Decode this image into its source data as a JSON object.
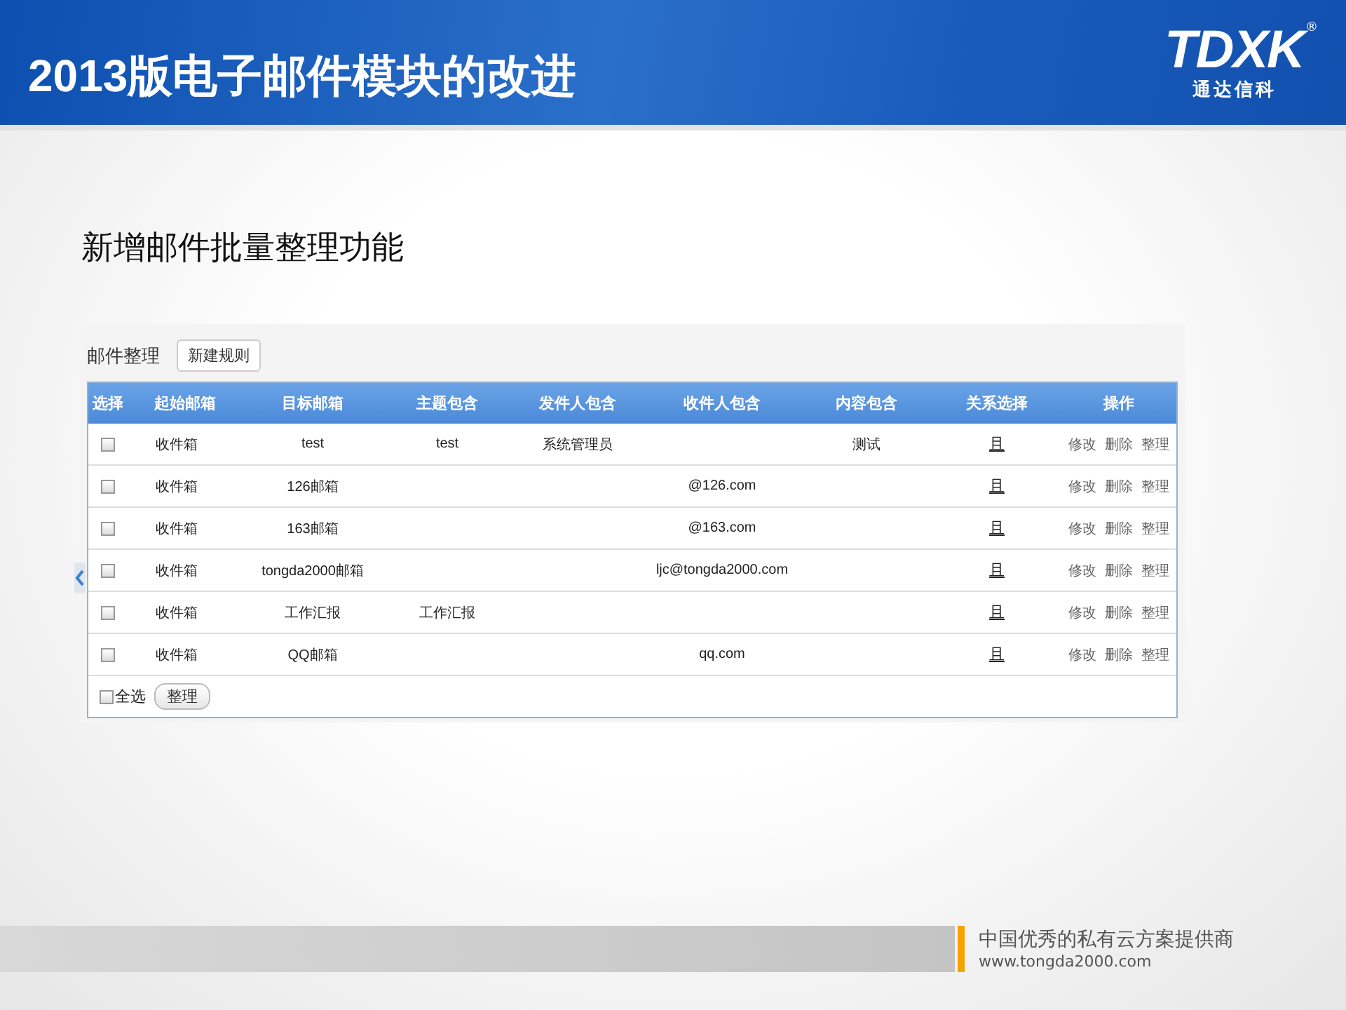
{
  "slide": {
    "title": "2013版电子邮件模块的改进",
    "logo": {
      "mark": "TDXK",
      "name": "通达信科",
      "registered": "®"
    },
    "subtitle": "新增邮件批量整理功能"
  },
  "panel": {
    "title": "邮件整理",
    "new_rule_button": "新建规则",
    "columns": [
      "选择",
      "起始邮箱",
      "目标邮箱",
      "主题包含",
      "发件人包含",
      "收件人包含",
      "内容包含",
      "关系选择",
      "操作"
    ],
    "rows": [
      {
        "checked": false,
        "source": "收件箱",
        "target": "test",
        "subject": "test",
        "sender": "系统管理员",
        "content": "测试",
        "relation": "且",
        "actions": [
          "修改",
          "删除",
          "整理"
        ]
      },
      {
        "checked": false,
        "source": "收件箱",
        "target": "126邮箱",
        "recipient": "@126.com",
        "relation": "且",
        "actions": [
          "修改",
          "删除",
          "整理"
        ]
      },
      {
        "checked": false,
        "source": "收件箱",
        "target": "163邮箱",
        "recipient": "@163.com",
        "relation": "且",
        "actions": [
          "修改",
          "删除",
          "整理"
        ]
      },
      {
        "checked": false,
        "source": "收件箱",
        "target": "tongda2000邮箱",
        "recipient": "ljc@tongda2000.com",
        "relation": "且",
        "actions": [
          "修改",
          "删除",
          "整理"
        ]
      },
      {
        "checked": false,
        "source": "收件箱",
        "target": "工作汇报",
        "subject": "工作汇报",
        "relation": "且",
        "actions": [
          "修改",
          "删除",
          "整理"
        ]
      },
      {
        "checked": false,
        "source": "收件箱",
        "target": "QQ邮箱",
        "recipient": "qq.com",
        "relation": "且",
        "actions": [
          "修改",
          "删除",
          "整理"
        ]
      }
    ],
    "select_all": {
      "label": "全选",
      "checked": false
    },
    "sort_button": "整理"
  },
  "footer": {
    "tagline": "中国优秀的私有云方案提供商",
    "url": "www.tongda2000.com"
  }
}
